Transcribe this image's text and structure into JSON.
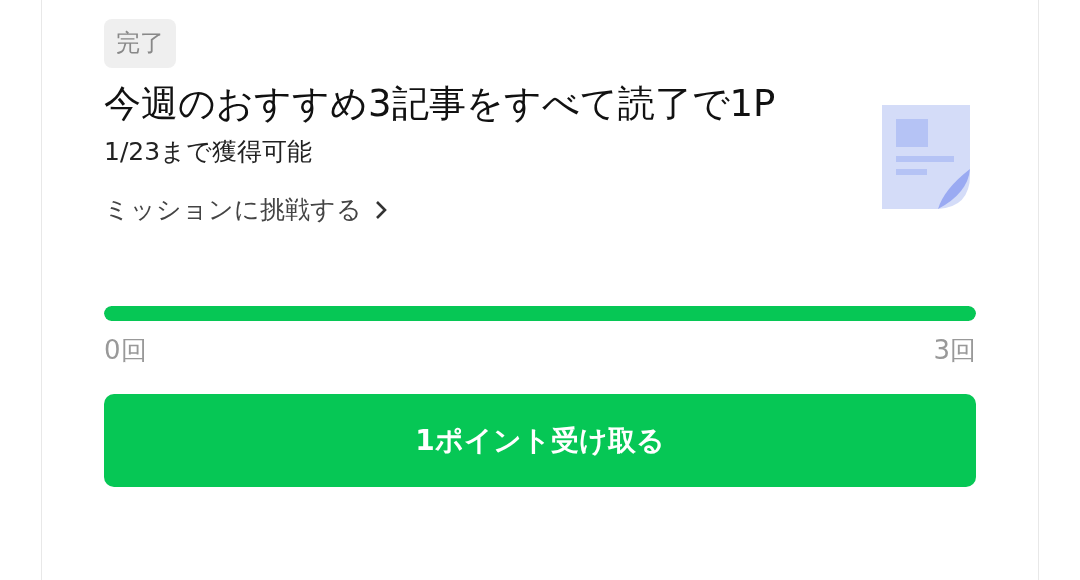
{
  "mission": {
    "badge": "完了",
    "title": "今週のおすすめ3記事をすべて読了で1P",
    "deadline": "1/23まで獲得可能",
    "link": "ミッションに挑戦する",
    "progress": {
      "level": 1,
      "min_label": "0回",
      "max_label": "3回"
    },
    "button": "1ポイント受け取る"
  }
}
